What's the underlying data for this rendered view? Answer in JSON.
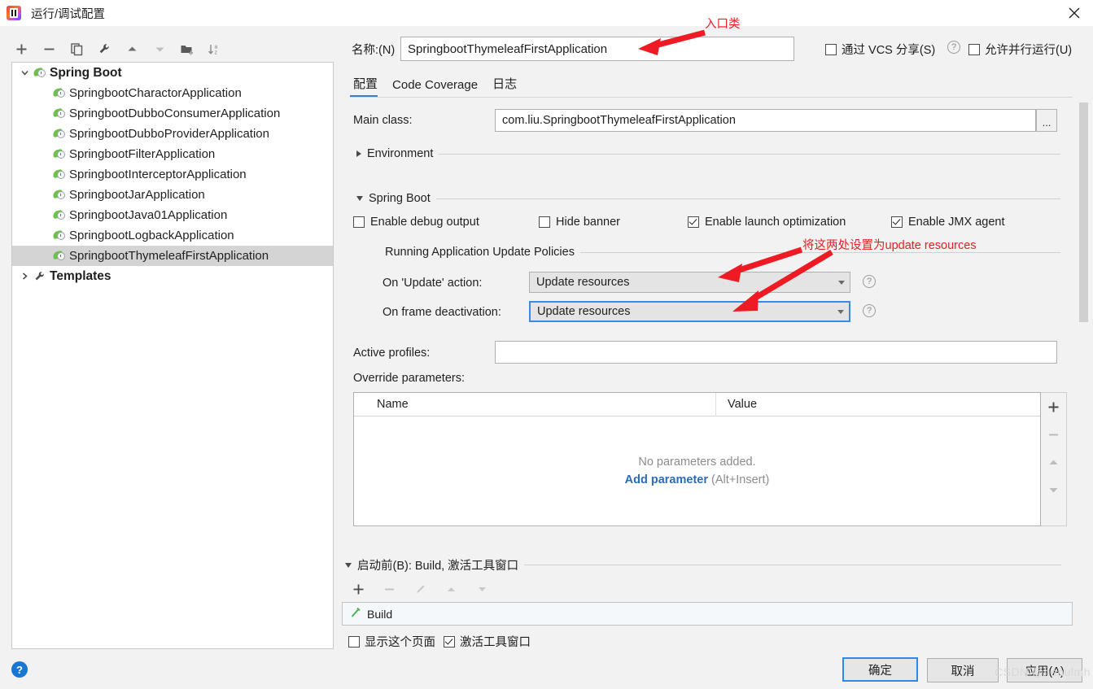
{
  "window": {
    "title": "运行/调试配置",
    "app_icon": "intellij-idea-icon",
    "close_icon": "close-icon"
  },
  "left_toolbar": {
    "items": [
      {
        "name": "add-configuration-button",
        "icon": "plus-icon",
        "label": "+"
      },
      {
        "name": "remove-configuration-button",
        "icon": "minus-icon",
        "label": "−"
      },
      {
        "name": "copy-configuration-button",
        "icon": "copy-icon",
        "label": "copy"
      },
      {
        "name": "edit-templates-button",
        "icon": "wrench-icon",
        "label": "wrench"
      },
      {
        "name": "move-up-button",
        "icon": "arrow-up-icon",
        "label": "▲"
      },
      {
        "name": "move-down-button",
        "icon": "arrow-down-icon",
        "label": "▼"
      },
      {
        "name": "new-folder-button",
        "icon": "folder-add-icon",
        "label": "folder"
      },
      {
        "name": "sort-button",
        "icon": "sort-alpha-icon",
        "label": "sort"
      }
    ]
  },
  "tree": {
    "group": {
      "label": "Spring Boot",
      "icon": "spring-boot-icon",
      "expanded": true
    },
    "items": [
      {
        "label": "SpringbootCharactorApplication",
        "icon": "spring-boot-icon",
        "selected": false
      },
      {
        "label": "SpringbootDubboConsumerApplication",
        "icon": "spring-boot-icon",
        "selected": false
      },
      {
        "label": "SpringbootDubboProviderApplication",
        "icon": "spring-boot-icon",
        "selected": false
      },
      {
        "label": "SpringbootFilterApplication",
        "icon": "spring-boot-icon",
        "selected": false
      },
      {
        "label": "SpringbootInterceptorApplication",
        "icon": "spring-boot-icon",
        "selected": false
      },
      {
        "label": "SpringbootJarApplication",
        "icon": "spring-boot-icon",
        "selected": false
      },
      {
        "label": "SpringbootJava01Application",
        "icon": "spring-boot-icon",
        "selected": false
      },
      {
        "label": "SpringbootLogbackApplication",
        "icon": "spring-boot-icon",
        "selected": false
      },
      {
        "label": "SpringbootThymeleafFirstApplication",
        "icon": "spring-boot-icon",
        "selected": true
      }
    ],
    "templates": {
      "label": "Templates",
      "icon": "wrench-icon",
      "expanded": false
    }
  },
  "name_row": {
    "label": "名称:(N)",
    "value": "SpringbootThymeleafFirstApplication",
    "share_vcs": {
      "label": "通过 VCS 分享(S)",
      "checked": false
    },
    "share_help_icon": "help-icon",
    "allow_parallel": {
      "label": "允许并行运行(U)",
      "checked": false
    }
  },
  "tabs": [
    {
      "label": "配置",
      "active": true
    },
    {
      "label": "Code Coverage",
      "active": false
    },
    {
      "label": "日志",
      "active": false
    }
  ],
  "config": {
    "main_class_label": "Main class:",
    "main_class_value": "com.liu.SpringbootThymeleafFirstApplication",
    "browse_button_label": "...",
    "environment_section": "Environment",
    "spring_boot_section": "Spring Boot",
    "checkboxes": [
      {
        "label": "Enable debug output",
        "checked": false
      },
      {
        "label": "Hide banner",
        "checked": false
      },
      {
        "label": "Enable launch optimization",
        "checked": true
      },
      {
        "label": "Enable JMX agent",
        "checked": true
      }
    ],
    "update_policies_title": "Running Application Update Policies",
    "on_update_label": "On 'Update' action:",
    "on_update_value": "Update resources",
    "on_frame_label": "On frame deactivation:",
    "on_frame_value": "Update resources",
    "active_profiles_label": "Active profiles:",
    "active_profiles_value": "",
    "override_params_label": "Override parameters:",
    "table": {
      "columns": [
        "Name",
        "Value"
      ],
      "rows": [],
      "empty_text": "No parameters added.",
      "add_link": "Add parameter",
      "add_hint": "(Alt+Insert)"
    },
    "side_buttons": [
      {
        "name": "add-parameter-button",
        "icon": "plus-icon",
        "enabled": true
      },
      {
        "name": "remove-parameter-button",
        "icon": "minus-icon",
        "enabled": false
      },
      {
        "name": "move-parameter-up-button",
        "icon": "arrow-up-icon",
        "enabled": false
      },
      {
        "name": "move-parameter-down-button",
        "icon": "arrow-down-icon",
        "enabled": false
      }
    ]
  },
  "before_launch": {
    "title": "启动前(B): Build, 激活工具窗口",
    "toolbar": [
      {
        "name": "add-task-button",
        "icon": "plus-icon",
        "enabled": true
      },
      {
        "name": "remove-task-button",
        "icon": "minus-icon",
        "enabled": false
      },
      {
        "name": "edit-task-button",
        "icon": "pencil-icon",
        "enabled": false
      },
      {
        "name": "task-up-button",
        "icon": "arrow-up-icon",
        "enabled": false
      },
      {
        "name": "task-down-button",
        "icon": "arrow-down-icon",
        "enabled": false
      }
    ],
    "tasks": [
      {
        "label": "Build",
        "icon": "build-hammer-icon"
      }
    ],
    "show_page": {
      "label": "显示这个页面",
      "checked": false
    },
    "activate_tool_window": {
      "label": "激活工具窗口",
      "checked": true
    }
  },
  "footer": {
    "help_icon": "help-icon",
    "ok_label": "确定",
    "cancel_label": "取消",
    "apply_label": "应用(A)",
    "watermark": "CSDN @henulmh"
  },
  "annotations": [
    {
      "text": "入口类",
      "color": "#ee1b24"
    },
    {
      "text": "将这两处设置为update resources",
      "color": "#ee1b24"
    }
  ]
}
